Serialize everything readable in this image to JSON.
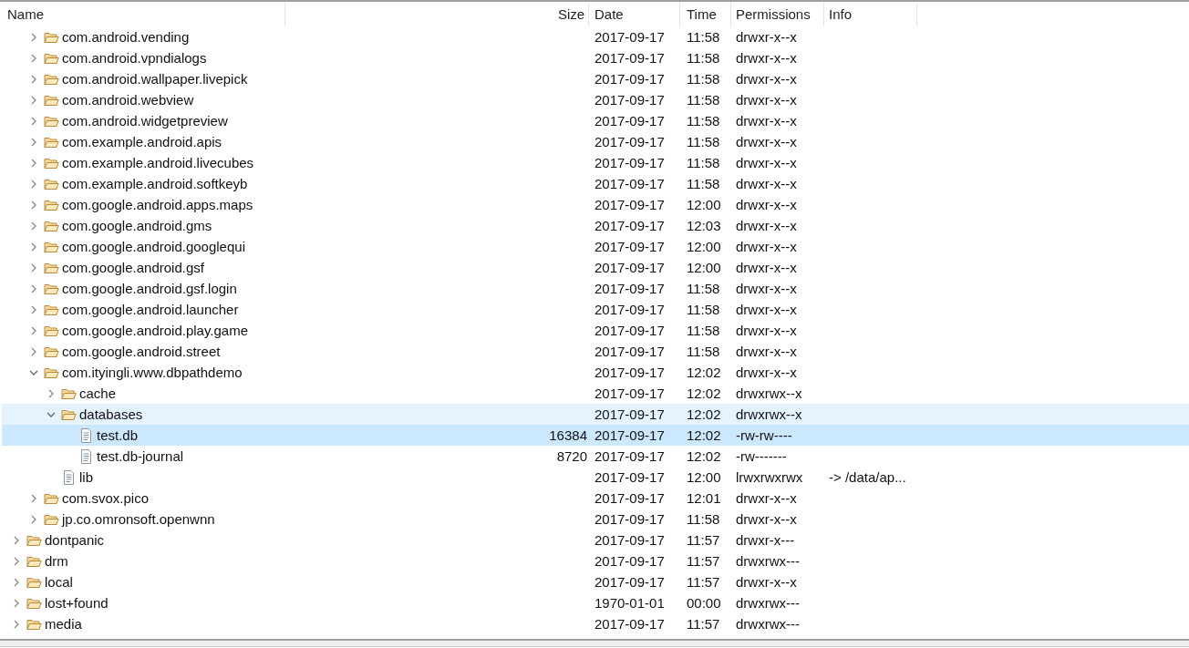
{
  "columns": [
    {
      "label": "Name",
      "kind": "name"
    },
    {
      "label": "Size",
      "kind": "size"
    },
    {
      "label": "Date",
      "kind": "date"
    },
    {
      "label": "Time",
      "kind": "time"
    },
    {
      "label": "Permissions",
      "kind": "permissions"
    },
    {
      "label": "Info",
      "kind": "info"
    }
  ],
  "tree": [
    {
      "children": [
        {
          "children": [
            {
              "name": "com.android.vending",
              "kind": "folder",
              "expanded": false,
              "selected": false,
              "hovered": false,
              "date": "2017-09-17",
              "time": "11:58",
              "permissions": "drwxr-x--x"
            },
            {
              "name": "com.android.vpndialogs",
              "kind": "folder",
              "expanded": false,
              "selected": false,
              "hovered": false,
              "date": "2017-09-17",
              "time": "11:58",
              "permissions": "drwxr-x--x"
            },
            {
              "name": "com.android.wallpaper.livepick",
              "kind": "folder",
              "expanded": false,
              "selected": false,
              "hovered": false,
              "date": "2017-09-17",
              "time": "11:58",
              "permissions": "drwxr-x--x"
            },
            {
              "name": "com.android.webview",
              "kind": "folder",
              "expanded": false,
              "selected": false,
              "hovered": false,
              "date": "2017-09-17",
              "time": "11:58",
              "permissions": "drwxr-x--x"
            },
            {
              "name": "com.android.widgetpreview",
              "kind": "folder",
              "expanded": false,
              "selected": false,
              "hovered": false,
              "date": "2017-09-17",
              "time": "11:58",
              "permissions": "drwxr-x--x"
            },
            {
              "name": "com.example.android.apis",
              "kind": "folder",
              "expanded": false,
              "selected": false,
              "hovered": false,
              "date": "2017-09-17",
              "time": "11:58",
              "permissions": "drwxr-x--x"
            },
            {
              "name": "com.example.android.livecubes",
              "kind": "folder",
              "expanded": false,
              "selected": false,
              "hovered": false,
              "date": "2017-09-17",
              "time": "11:58",
              "permissions": "drwxr-x--x"
            },
            {
              "name": "com.example.android.softkeyb",
              "kind": "folder",
              "expanded": false,
              "selected": false,
              "hovered": false,
              "date": "2017-09-17",
              "time": "11:58",
              "permissions": "drwxr-x--x"
            },
            {
              "name": "com.google.android.apps.maps",
              "kind": "folder",
              "expanded": false,
              "selected": false,
              "hovered": false,
              "date": "2017-09-17",
              "time": "12:00",
              "permissions": "drwxr-x--x"
            },
            {
              "name": "com.google.android.gms",
              "kind": "folder",
              "expanded": false,
              "selected": false,
              "hovered": false,
              "date": "2017-09-17",
              "time": "12:03",
              "permissions": "drwxr-x--x"
            },
            {
              "name": "com.google.android.googlequi",
              "kind": "folder",
              "expanded": false,
              "selected": false,
              "hovered": false,
              "date": "2017-09-17",
              "time": "12:00",
              "permissions": "drwxr-x--x"
            },
            {
              "name": "com.google.android.gsf",
              "kind": "folder",
              "expanded": false,
              "selected": false,
              "hovered": false,
              "date": "2017-09-17",
              "time": "12:00",
              "permissions": "drwxr-x--x"
            },
            {
              "name": "com.google.android.gsf.login",
              "kind": "folder",
              "expanded": false,
              "selected": false,
              "hovered": false,
              "date": "2017-09-17",
              "time": "11:58",
              "permissions": "drwxr-x--x"
            },
            {
              "name": "com.google.android.launcher",
              "kind": "folder",
              "expanded": false,
              "selected": false,
              "hovered": false,
              "date": "2017-09-17",
              "time": "11:58",
              "permissions": "drwxr-x--x"
            },
            {
              "name": "com.google.android.play.game",
              "kind": "folder",
              "expanded": false,
              "selected": false,
              "hovered": false,
              "date": "2017-09-17",
              "time": "11:58",
              "permissions": "drwxr-x--x"
            },
            {
              "name": "com.google.android.street",
              "kind": "folder",
              "expanded": false,
              "selected": false,
              "hovered": false,
              "date": "2017-09-17",
              "time": "11:58",
              "permissions": "drwxr-x--x"
            },
            {
              "name": "com.ityingli.www.dbpathdemo",
              "kind": "folder",
              "expanded": true,
              "selected": false,
              "hovered": false,
              "date": "2017-09-17",
              "time": "12:02",
              "permissions": "drwxr-x--x",
              "children": [
                {
                  "name": "cache",
                  "kind": "folder",
                  "expanded": false,
                  "selected": false,
                  "hovered": false,
                  "date": "2017-09-17",
                  "time": "12:02",
                  "permissions": "drwxrwx--x"
                },
                {
                  "name": "databases",
                  "kind": "folder",
                  "expanded": true,
                  "selected": false,
                  "hovered": true,
                  "date": "2017-09-17",
                  "time": "12:02",
                  "permissions": "drwxrwx--x",
                  "children": [
                    {
                      "name": "test.db",
                      "kind": "file",
                      "selected": true,
                      "hovered": false,
                      "size": "16384",
                      "date": "2017-09-17",
                      "time": "12:02",
                      "permissions": "-rw-rw----"
                    },
                    {
                      "name": "test.db-journal",
                      "kind": "file",
                      "selected": false,
                      "hovered": false,
                      "size": "8720",
                      "date": "2017-09-17",
                      "time": "12:02",
                      "permissions": "-rw-------"
                    }
                  ]
                },
                {
                  "name": "lib",
                  "kind": "file",
                  "selected": false,
                  "hovered": false,
                  "date": "2017-09-17",
                  "time": "12:00",
                  "permissions": "lrwxrwxrwx",
                  "info": "-> /data/ap..."
                }
              ]
            },
            {
              "name": "com.svox.pico",
              "kind": "folder",
              "expanded": false,
              "selected": false,
              "hovered": false,
              "date": "2017-09-17",
              "time": "12:01",
              "permissions": "drwxr-x--x"
            },
            {
              "name": "jp.co.omronsoft.openwnn",
              "kind": "folder",
              "expanded": false,
              "selected": false,
              "hovered": false,
              "date": "2017-09-17",
              "time": "11:58",
              "permissions": "drwxr-x--x"
            }
          ]
        },
        {
          "name": "dontpanic",
          "kind": "folder",
          "expanded": false,
          "selected": false,
          "hovered": false,
          "date": "2017-09-17",
          "time": "11:57",
          "permissions": "drwxr-x---"
        },
        {
          "name": "drm",
          "kind": "folder",
          "expanded": false,
          "selected": false,
          "hovered": false,
          "date": "2017-09-17",
          "time": "11:57",
          "permissions": "drwxrwx---"
        },
        {
          "name": "local",
          "kind": "folder",
          "expanded": false,
          "selected": false,
          "hovered": false,
          "date": "2017-09-17",
          "time": "11:57",
          "permissions": "drwxr-x--x"
        },
        {
          "name": "lost+found",
          "kind": "folder",
          "expanded": false,
          "selected": false,
          "hovered": false,
          "date": "1970-01-01",
          "time": "00:00",
          "permissions": "drwxrwx---"
        },
        {
          "name": "media",
          "kind": "folder",
          "expanded": false,
          "selected": false,
          "hovered": false,
          "date": "2017-09-17",
          "time": "11:57",
          "permissions": "drwxrwx---"
        }
      ]
    }
  ]
}
